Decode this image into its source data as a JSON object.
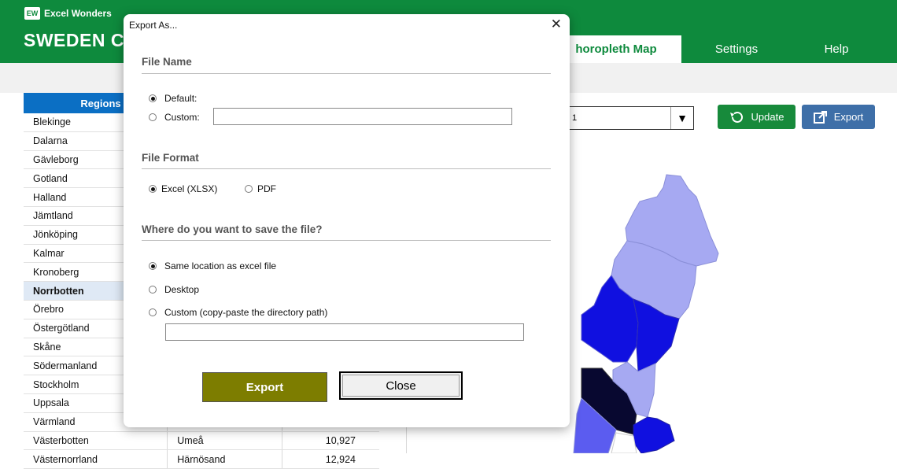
{
  "app": {
    "brand": "Excel Wonders",
    "brand_logo": "EW",
    "title": "SWEDEN CH"
  },
  "nav": {
    "tabs": [
      {
        "label": "horopleth Map"
      },
      {
        "label": "Settings"
      },
      {
        "label": "Help"
      }
    ]
  },
  "regions": {
    "header": "Regions",
    "selected": "Norrbotten",
    "rows": [
      {
        "name": "Blekinge",
        "capital": "",
        "value": ""
      },
      {
        "name": "Dalarna",
        "capital": "",
        "value": ""
      },
      {
        "name": "Gävleborg",
        "capital": "",
        "value": ""
      },
      {
        "name": "Gotland",
        "capital": "",
        "value": ""
      },
      {
        "name": "Halland",
        "capital": "",
        "value": ""
      },
      {
        "name": "Jämtland",
        "capital": "",
        "value": ""
      },
      {
        "name": "Jönköping",
        "capital": "",
        "value": ""
      },
      {
        "name": "Kalmar",
        "capital": "",
        "value": ""
      },
      {
        "name": "Kronoberg",
        "capital": "",
        "value": ""
      },
      {
        "name": "Norrbotten",
        "capital": "",
        "value": ""
      },
      {
        "name": "Örebro",
        "capital": "",
        "value": ""
      },
      {
        "name": "Östergötland",
        "capital": "",
        "value": ""
      },
      {
        "name": "Skåne",
        "capital": "",
        "value": ""
      },
      {
        "name": "Södermanland",
        "capital": "",
        "value": ""
      },
      {
        "name": "Stockholm",
        "capital": "",
        "value": ""
      },
      {
        "name": "Uppsala",
        "capital": "",
        "value": ""
      },
      {
        "name": "Värmland",
        "capital": "",
        "value": ""
      },
      {
        "name": "Västerbotten",
        "capital": "Umeå",
        "value": "10,927"
      },
      {
        "name": "Västernorrland",
        "capital": "Härnösand",
        "value": "12,924"
      }
    ]
  },
  "toolbar": {
    "dropdown_value": "1",
    "update_label": "Update",
    "export_label": "Export"
  },
  "map_colors": {
    "light": "#a6a9f2",
    "medium": "#5b5cf0",
    "strong": "#1010e0",
    "dark": "#080830",
    "white_region": "#ffffff"
  },
  "dialog": {
    "title": "Export As...",
    "file_name": {
      "heading": "File Name",
      "default_label": "Default:",
      "custom_label": "Custom:",
      "custom_value": "",
      "selected": "default"
    },
    "file_format": {
      "heading": "File Format",
      "xlsx_label": "Excel (XLSX)",
      "pdf_label": "PDF",
      "selected": "xlsx"
    },
    "save_location": {
      "heading": "Where do you want to save the file?",
      "same_label": "Same location as excel file",
      "desktop_label": "Desktop",
      "custom_label": "Custom (copy-paste the directory path)",
      "custom_value": "",
      "selected": "same"
    },
    "export_button": "Export",
    "close_button": "Close"
  }
}
